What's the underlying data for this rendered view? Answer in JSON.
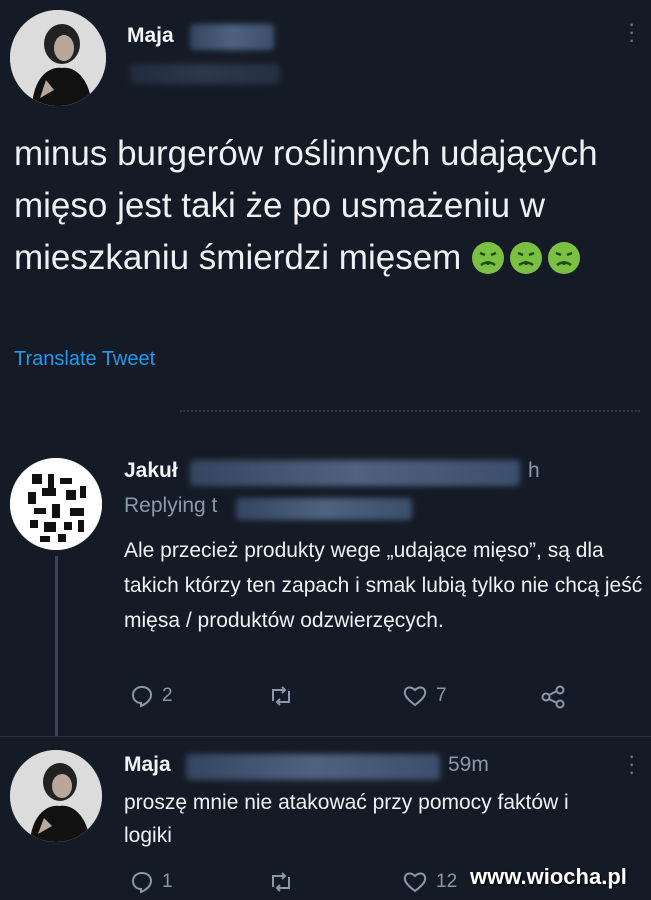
{
  "main_tweet": {
    "author": "Maja",
    "text": "minus burgerów roślinnych udających mięso jest taki że po usmażeniu w mieszkaniu śmierdzi mięsem",
    "emojis": [
      "nauseated-face-icon",
      "nauseated-face-icon",
      "nauseated-face-icon"
    ],
    "translate_label": "Translate Tweet"
  },
  "reply1": {
    "author": "Jakuł",
    "time": "h",
    "replying_prefix": "Replying t",
    "text": "Ale przecież produkty wege „udające mięso”, są dla takich którzy ten zapach i smak lubią tylko nie chcą jeść mięsa / produktów odzwierzęcych.",
    "replies": "2",
    "likes": "7"
  },
  "reply2": {
    "author": "Maja",
    "time": "59m",
    "text": "proszę mnie nie atakować przy pomocy faktów i logiki",
    "replies": "1",
    "likes": "12"
  },
  "watermark": "www.wiocha.pl",
  "colors": {
    "background": "#151b26",
    "link": "#1d9bf0",
    "emoji": "#7bc043"
  }
}
